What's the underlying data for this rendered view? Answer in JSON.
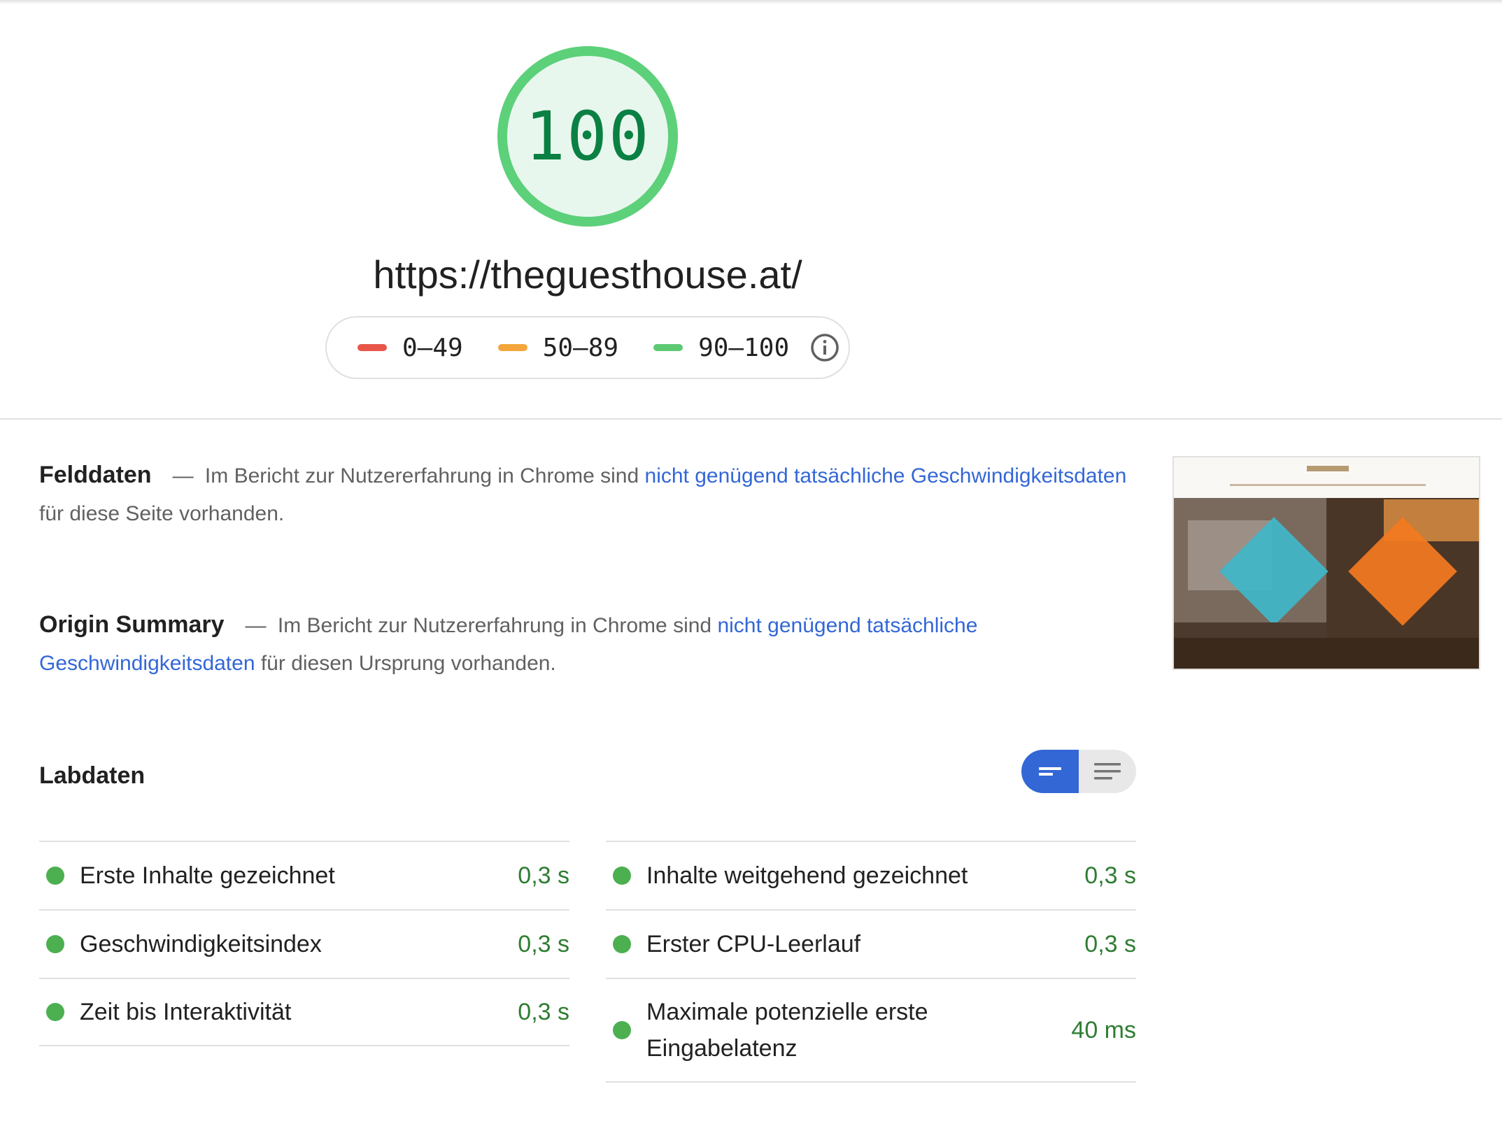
{
  "report": {
    "score": "100",
    "score_color": "#0cce6b",
    "url": "https://theguesthouse.at/"
  },
  "legend": {
    "items": [
      {
        "range": "0–49",
        "color": "#ff4e42"
      },
      {
        "range": "50–89",
        "color": "#ffa400"
      },
      {
        "range": "90–100",
        "color": "#0cce6b"
      }
    ],
    "info_icon": "info-icon"
  },
  "field_data": {
    "title": "Felddaten",
    "dash": "—",
    "text_before": "Im Bericht zur Nutzererfahrung in Chrome sind ",
    "link": "nicht genügend tatsächliche Geschwindigkeitsdaten",
    "text_after": " für diese Seite vorhanden."
  },
  "origin_summary": {
    "title": "Origin Summary",
    "dash": "—",
    "text_before": "Im Bericht zur Nutzererfahrung in Chrome sind ",
    "link": "nicht genügend tatsächliche Geschwindigkeitsdaten",
    "text_after": " für diesen Ursprung vorhanden."
  },
  "lab_data": {
    "title": "Labdaten",
    "toggle": {
      "active": "compact-view-icon",
      "inactive": "detailed-view-icon"
    },
    "metrics_left": [
      {
        "label": "Erste Inhalte gezeichnet",
        "value": "0,3 s"
      },
      {
        "label": "Geschwindigkeitsindex",
        "value": "0,3 s"
      },
      {
        "label": "Zeit bis Interaktivität",
        "value": "0,3 s"
      }
    ],
    "metrics_right": [
      {
        "label": "Inhalte weitgehend gezeichnet",
        "value": "0,3 s"
      },
      {
        "label": "Erster CPU-Leerlauf",
        "value": "0,3 s"
      },
      {
        "label": "Maximale potenzielle erste Eingabelatenz",
        "value": "40 ms"
      }
    ]
  }
}
